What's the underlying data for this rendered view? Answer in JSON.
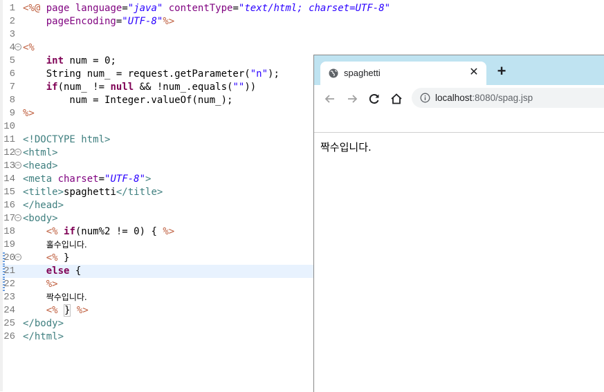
{
  "editor": {
    "line_numbers": [
      "1",
      "2",
      "3",
      "4",
      "5",
      "6",
      "7",
      "8",
      "9",
      "10",
      "11",
      "12",
      "13",
      "14",
      "15",
      "16",
      "17",
      "18",
      "19",
      "20",
      "21",
      "22",
      "23",
      "24",
      "25",
      "26"
    ],
    "lines": {
      "l1": {
        "a": "<%@",
        "b": " page ",
        "c": "language",
        "d": "=",
        "e": "\"java\"",
        "f": " contentType",
        "g": "=",
        "h": "\"text/html; charset=UTF-8\""
      },
      "l2": {
        "a": "    pageEncoding",
        "b": "=",
        "c": "\"UTF-8\"",
        "d": "%>"
      },
      "l4": {
        "a": "<%"
      },
      "l5": {
        "a": "    ",
        "b": "int",
        "c": " num = 0;"
      },
      "l6": {
        "a": "    String num_ = request.getParameter(",
        "b": "\"n\"",
        "c": ");"
      },
      "l7": {
        "a": "    ",
        "b": "if",
        "c": "(num_ != ",
        "d": "null",
        "e": " && !num_.equals(",
        "f": "\"\"",
        "g": "))"
      },
      "l8": {
        "a": "        num = Integer.valueOf(num_);"
      },
      "l9": {
        "a": "%>"
      },
      "l11": {
        "a": "<!DOCTYPE html>"
      },
      "l12": {
        "a": "<html>"
      },
      "l13": {
        "a": "<head>"
      },
      "l14": {
        "a": "<meta ",
        "b": "charset",
        "c": "=",
        "d": "\"UTF-8\"",
        "e": ">"
      },
      "l15": {
        "a": "<title>",
        "b": "spaghetti",
        "c": "</title>"
      },
      "l16": {
        "a": "</head>"
      },
      "l17": {
        "a": "<body>"
      },
      "l18": {
        "a": "    ",
        "b": "<%",
        "c": " ",
        "d": "if",
        "e": "(num%2 != 0) { ",
        "f": "%>"
      },
      "l19": {
        "a": "    ",
        "b": "홀수입니다."
      },
      "l20": {
        "a": "    ",
        "b": "<%",
        "c": " }"
      },
      "l21": {
        "a": "    ",
        "b": "else",
        "c": " {"
      },
      "l22": {
        "a": "    ",
        "b": "%>"
      },
      "l23": {
        "a": "    ",
        "b": "짝수입니다."
      },
      "l24": {
        "a": "    ",
        "b": "<%",
        "c": " ",
        "d": "}",
        "e": " ",
        "f": "%>"
      },
      "l25": {
        "a": "</body>"
      },
      "l26": {
        "a": "</html>"
      }
    }
  },
  "browser": {
    "tab_title": "spaghetti",
    "tab_close": "✕",
    "new_tab": "+",
    "url_host": "localhost",
    "url_path": ":8080/spag.jsp",
    "page_text": "짝수입니다.",
    "icons": [
      "globe-icon",
      "close-icon",
      "plus-icon",
      "back-icon",
      "forward-icon",
      "reload-icon",
      "home-icon",
      "info-icon"
    ],
    "colors": {
      "tabbar": "#bfe3f1",
      "omnibox": "#f1f3f4"
    }
  }
}
